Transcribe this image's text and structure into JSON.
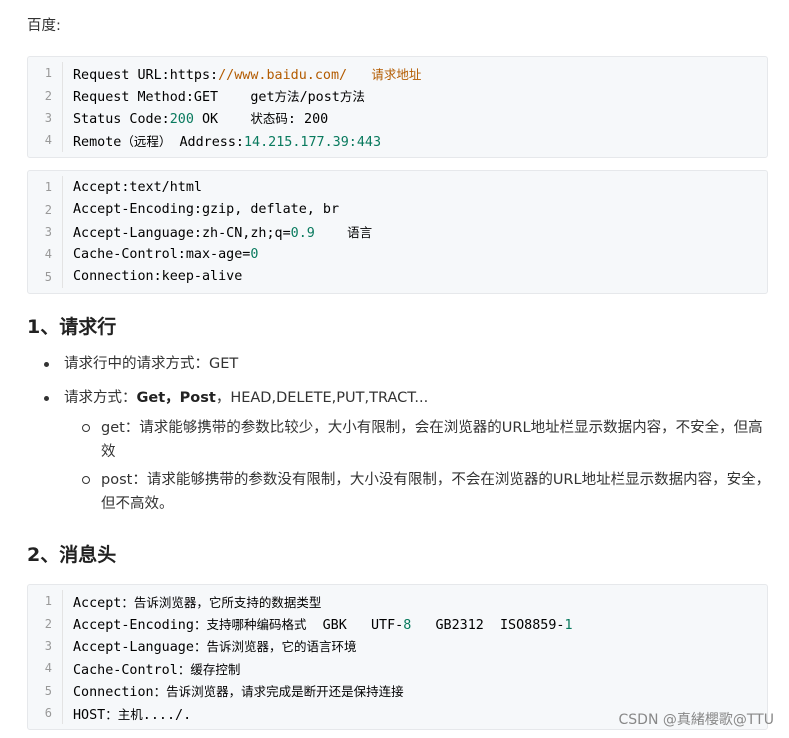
{
  "intro": "百度:",
  "block1": [
    {
      "n": "1",
      "parts": [
        {
          "t": "Request URL:https:"
        },
        {
          "t": "//www.baidu.com/",
          "c": "str"
        },
        {
          "t": "   "
        },
        {
          "t": "请求地址",
          "c": "cn-str"
        }
      ]
    },
    {
      "n": "2",
      "parts": [
        {
          "t": "Request Method:GET    get"
        },
        {
          "t": "方法",
          "c": "cn"
        },
        {
          "t": "/post"
        },
        {
          "t": "方法",
          "c": "cn"
        }
      ]
    },
    {
      "n": "3",
      "parts": [
        {
          "t": "Status Code:"
        },
        {
          "t": "200",
          "c": "num"
        },
        {
          "t": " OK    "
        },
        {
          "t": "状态码",
          "c": "cn"
        },
        {
          "t": ": 200"
        }
      ]
    },
    {
      "n": "4",
      "parts": [
        {
          "t": "Remote"
        },
        {
          "t": "（远程）",
          "c": "cn"
        },
        {
          "t": " Address:"
        },
        {
          "t": "14.215.177.39:443",
          "c": "num"
        }
      ]
    }
  ],
  "block2": [
    {
      "n": "1",
      "parts": [
        {
          "t": "Accept:text/html"
        }
      ]
    },
    {
      "n": "2",
      "parts": [
        {
          "t": "Accept-Encoding:gzip, deflate, br"
        }
      ]
    },
    {
      "n": "3",
      "parts": [
        {
          "t": "Accept-Language:zh-CN,zh;q="
        },
        {
          "t": "0.9",
          "c": "num"
        },
        {
          "t": "    "
        },
        {
          "t": "语言",
          "c": "cn"
        }
      ]
    },
    {
      "n": "4",
      "parts": [
        {
          "t": "Cache-Control:max-age="
        },
        {
          "t": "0",
          "c": "num"
        }
      ]
    },
    {
      "n": "5",
      "parts": [
        {
          "t": "Connection:keep-alive"
        }
      ]
    }
  ],
  "heading1": "1、请求行",
  "list1": {
    "item1": "请求行中的请求方式：GET",
    "item2_prefix": "请求方式：",
    "item2_bold": "Get，Post",
    "item2_rest": "，HEAD,DELETE,PUT,TRACT...",
    "sub1": "get：请求能够携带的参数比较少，大小有限制，会在浏览器的URL地址栏显示数据内容，不安全，但高效",
    "sub2": "post：请求能够携带的参数没有限制，大小没有限制，不会在浏览器的URL地址栏显示数据内容，安全，但不高效。"
  },
  "heading2": "2、消息头",
  "block3": [
    {
      "n": "1",
      "parts": [
        {
          "t": "Accept"
        },
        {
          "t": "：告诉浏览器，它所支持的数据类型",
          "c": "cn"
        }
      ]
    },
    {
      "n": "2",
      "parts": [
        {
          "t": "Accept-Encoding"
        },
        {
          "t": "：支持哪种编码格式",
          "c": "cn"
        },
        {
          "t": "  GBK   UTF-"
        },
        {
          "t": "8",
          "c": "num"
        },
        {
          "t": "   GB2312  ISO8859-"
        },
        {
          "t": "1",
          "c": "num"
        }
      ]
    },
    {
      "n": "3",
      "parts": [
        {
          "t": "Accept-Language"
        },
        {
          "t": "：告诉浏览器，它的语言环境",
          "c": "cn"
        }
      ]
    },
    {
      "n": "4",
      "parts": [
        {
          "t": "Cache-Control"
        },
        {
          "t": "：缓存控制",
          "c": "cn"
        }
      ]
    },
    {
      "n": "5",
      "parts": [
        {
          "t": "Connection"
        },
        {
          "t": "：告诉浏览器，请求完成是断开还是保持连接",
          "c": "cn"
        }
      ]
    },
    {
      "n": "6",
      "parts": [
        {
          "t": "HOST"
        },
        {
          "t": "：主机",
          "c": "cn"
        },
        {
          "t": "..../."
        }
      ]
    }
  ],
  "watermark": "CSDN @真緒櫻歌@TTU"
}
